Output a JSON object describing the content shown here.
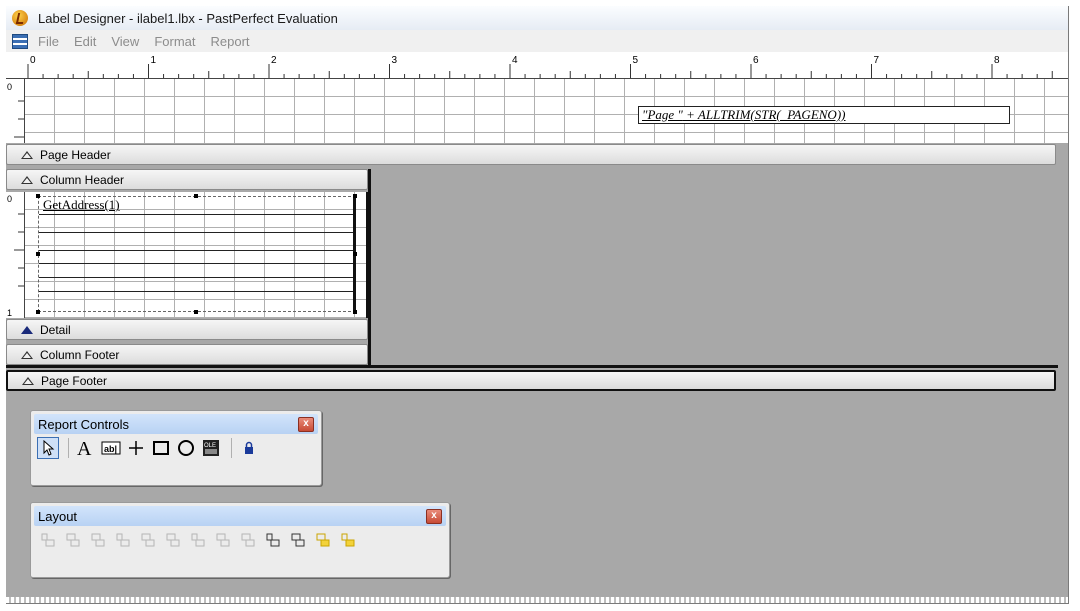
{
  "window": {
    "title": "Label Designer - ilabel1.lbx - PastPerfect Evaluation"
  },
  "menu": [
    "File",
    "Edit",
    "View",
    "Format",
    "Report"
  ],
  "ruler": {
    "numbers": [
      "0",
      "1",
      "2",
      "3",
      "4",
      "5",
      "6",
      "7",
      "8"
    ]
  },
  "page_header": {
    "field": {
      "quoted": "\"Page \"",
      "expr": " + ALLTRIM(STR(_PAGENO))"
    },
    "vruler_label": "0"
  },
  "bands": {
    "page_header": "Page Header",
    "column_header": "Column Header",
    "detail": "Detail",
    "column_footer": "Column Footer",
    "page_footer": "Page Footer"
  },
  "detail": {
    "field": "GetAddress(1)",
    "vruler_top": "0",
    "vruler_bottom": "1"
  },
  "report_controls": {
    "title": "Report Controls",
    "close": "x",
    "tools": [
      "pointer-tool",
      "label-tool",
      "field-tool",
      "line-tool",
      "rectangle-tool",
      "rounded-rectangle-tool",
      "picture-ole-tool",
      "lock-tool"
    ]
  },
  "layout_toolbar": {
    "title": "Layout",
    "close": "x",
    "tools": [
      "align-left",
      "align-right",
      "align-top",
      "align-bottom",
      "align-vertical-center",
      "align-horizontal-center",
      "same-width",
      "same-height",
      "same-size",
      "center-horizontally",
      "center-vertically",
      "bring-to-front",
      "send-to-back"
    ]
  }
}
